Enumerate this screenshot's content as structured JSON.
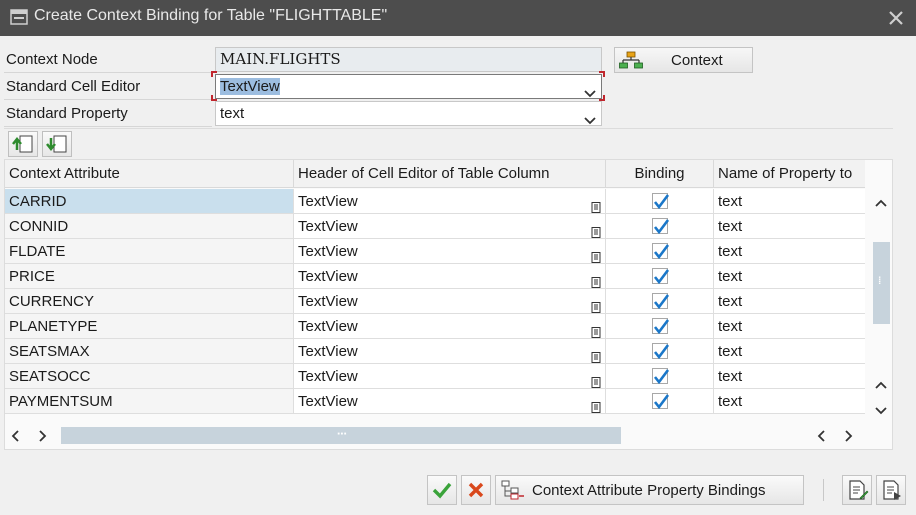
{
  "window": {
    "title": "Create Context Binding for Table \"FLIGHTTABLE\""
  },
  "form": {
    "context_node_label": "Context Node",
    "context_node_value": "MAIN.FLIGHTS",
    "cell_editor_label": "Standard Cell Editor",
    "cell_editor_value": "TextView",
    "property_label": "Standard Property",
    "property_value": "text",
    "context_button": "Context"
  },
  "table": {
    "columns": [
      "Context Attribute",
      "Header of Cell Editor of Table Column",
      "Binding",
      "Name of Property to"
    ],
    "rows": [
      {
        "attribute": "CARRID",
        "editor": "TextView",
        "binding": true,
        "property": "text"
      },
      {
        "attribute": "CONNID",
        "editor": "TextView",
        "binding": true,
        "property": "text"
      },
      {
        "attribute": "FLDATE",
        "editor": "TextView",
        "binding": true,
        "property": "text"
      },
      {
        "attribute": "PRICE",
        "editor": "TextView",
        "binding": true,
        "property": "text"
      },
      {
        "attribute": "CURRENCY",
        "editor": "TextView",
        "binding": true,
        "property": "text"
      },
      {
        "attribute": "PLANETYPE",
        "editor": "TextView",
        "binding": true,
        "property": "text"
      },
      {
        "attribute": "SEATSMAX",
        "editor": "TextView",
        "binding": true,
        "property": "text"
      },
      {
        "attribute": "SEATSOCC",
        "editor": "TextView",
        "binding": true,
        "property": "text"
      },
      {
        "attribute": "PAYMENTSUM",
        "editor": "TextView",
        "binding": true,
        "property": "text"
      }
    ],
    "selected_row": 0
  },
  "footer": {
    "bindings_button": "Context Attribute Property Bindings"
  },
  "colors": {
    "titlebar": "#4d4d4d",
    "checkmark_blue": "#1a77c9",
    "confirm_green": "#3aa33a",
    "cancel_red": "#d9481c",
    "focus_red": "#c0262d"
  },
  "icons": {
    "app": "window-icon",
    "close": "close-icon",
    "context": "hierarchy-icon",
    "insert_above": "insert-row-up-icon",
    "insert_below": "insert-row-down-icon",
    "confirm": "check-icon",
    "cancel": "cancel-icon",
    "bindings": "bindings-icon",
    "doc_a": "document-edit-icon",
    "doc_b": "document-list-icon"
  }
}
